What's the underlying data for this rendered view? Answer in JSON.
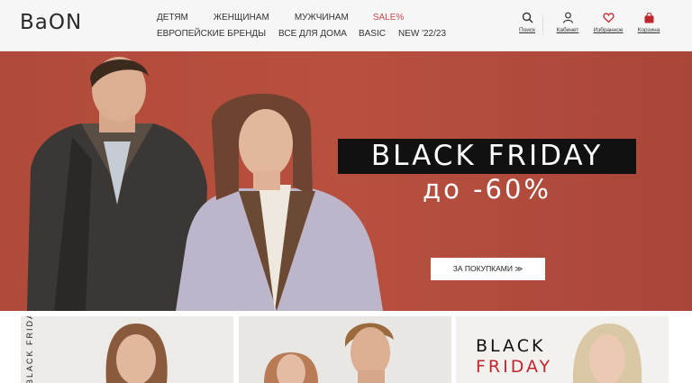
{
  "header": {
    "logo": "BaON",
    "nav_row1": [
      "ДЕТЯМ",
      "ЖЕНЩИНАМ",
      "МУЖЧИНАМ",
      "SALE%"
    ],
    "nav_row2": [
      "ЕВРОПЕЙСКИЕ БРЕНДЫ",
      "ВСЕ ДЛЯ ДОМА",
      "BASIC",
      "NEW '22/23"
    ],
    "tools": {
      "search": "Поиск",
      "account": "Кабинет",
      "favorites": "Избранное",
      "cart": "Корзина"
    },
    "colors": {
      "sale": "#c44a4f",
      "cart_icon": "#c0262e",
      "heart_icon": "#c0262e"
    }
  },
  "hero": {
    "title": "BLACK FRIDAY",
    "subtitle": "до -60%",
    "cta": "ЗА ПОКУПКАМИ ≫",
    "background": "#b04a3a"
  },
  "cards": {
    "card1_vertical": "BLACK FRIDAY",
    "card3_black": "BLACK",
    "card3_friday": "FRIDAY",
    "card3_friday_color": "#c0262e"
  }
}
